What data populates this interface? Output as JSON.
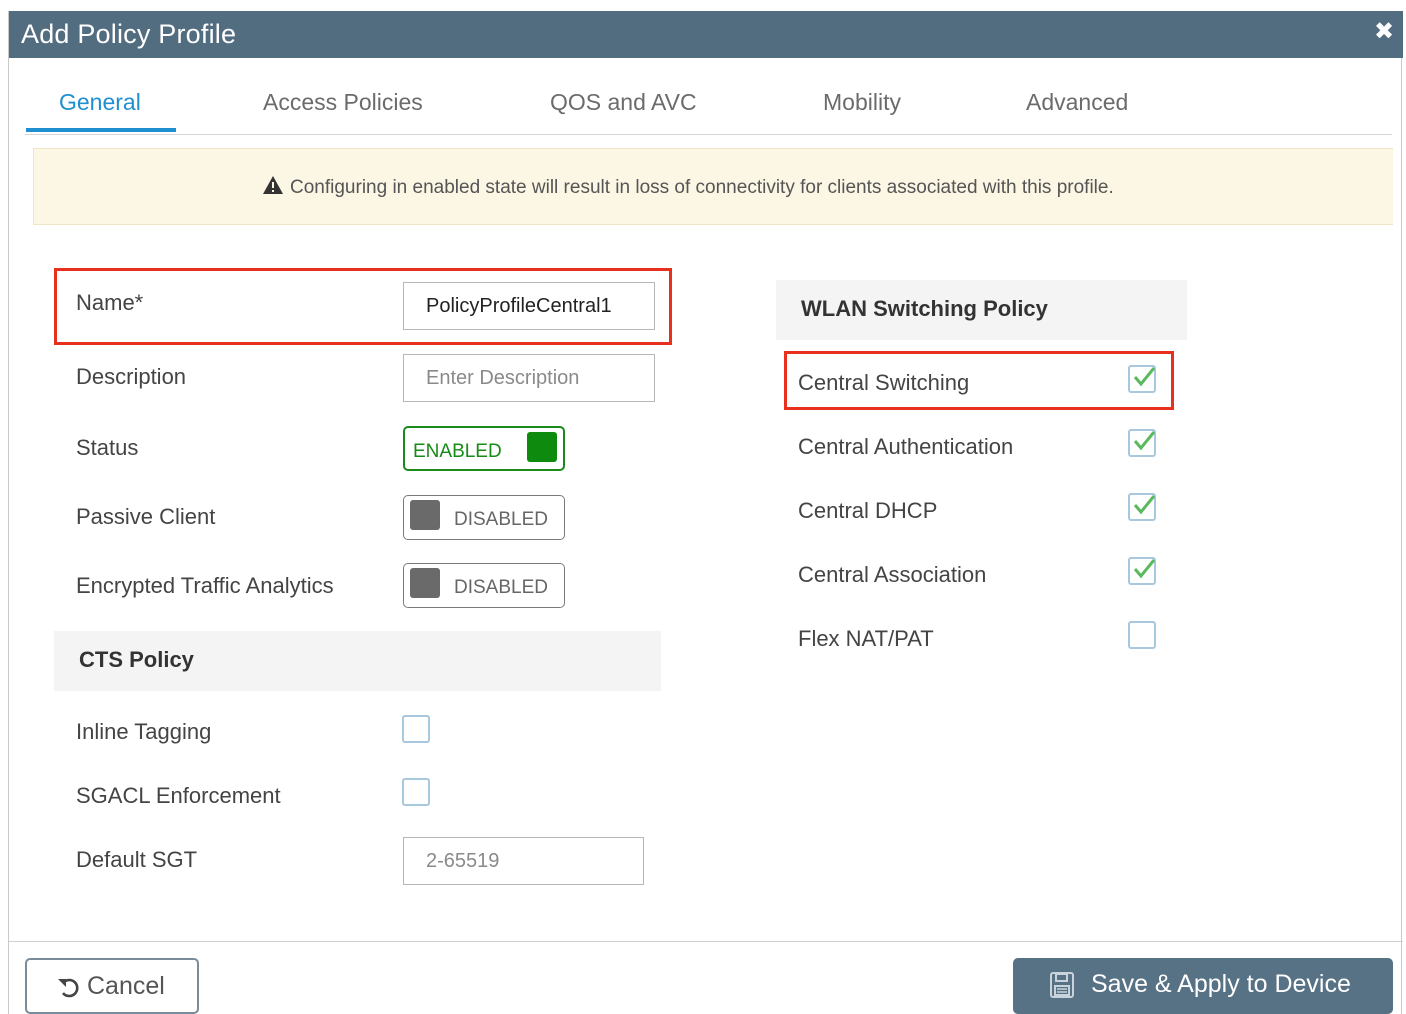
{
  "dialog": {
    "title": "Add Policy Profile",
    "close_icon": "close-icon"
  },
  "tabs": [
    {
      "label": "General",
      "active": true
    },
    {
      "label": "Access Policies",
      "active": false
    },
    {
      "label": "QOS and AVC",
      "active": false
    },
    {
      "label": "Mobility",
      "active": false
    },
    {
      "label": "Advanced",
      "active": false
    }
  ],
  "warning": {
    "icon": "warning-icon",
    "text": "Configuring in enabled state will result in loss of connectivity for clients associated with this profile."
  },
  "general": {
    "name": {
      "label": "Name*",
      "value": "PolicyProfileCentral1"
    },
    "description": {
      "label": "Description",
      "placeholder": "Enter Description"
    },
    "status": {
      "label": "Status",
      "state": "ENABLED"
    },
    "passive_client": {
      "label": "Passive Client",
      "state": "DISABLED"
    },
    "encrypted_traffic_analytics": {
      "label": "Encrypted Traffic Analytics",
      "state": "DISABLED"
    }
  },
  "cts_policy": {
    "heading": "CTS Policy",
    "inline_tagging": {
      "label": "Inline Tagging",
      "checked": false
    },
    "sgacl_enforcement": {
      "label": "SGACL Enforcement",
      "checked": false
    },
    "default_sgt": {
      "label": "Default SGT",
      "placeholder": "2-65519"
    }
  },
  "wlan_switching_policy": {
    "heading": "WLAN Switching Policy",
    "items": [
      {
        "label": "Central Switching",
        "checked": true
      },
      {
        "label": "Central Authentication",
        "checked": true
      },
      {
        "label": "Central DHCP",
        "checked": true
      },
      {
        "label": "Central Association",
        "checked": true
      },
      {
        "label": "Flex NAT/PAT",
        "checked": false
      }
    ]
  },
  "footer": {
    "cancel_label": "Cancel",
    "cancel_icon": "undo-icon",
    "save_label": "Save & Apply to Device",
    "save_icon": "save-icon"
  },
  "colors": {
    "titlebar": "#526c80",
    "tab_active": "#1f8fd0",
    "enabled_green": "#0e8a0e",
    "highlight_red": "#e8301f",
    "check_green": "#5cb85c"
  }
}
